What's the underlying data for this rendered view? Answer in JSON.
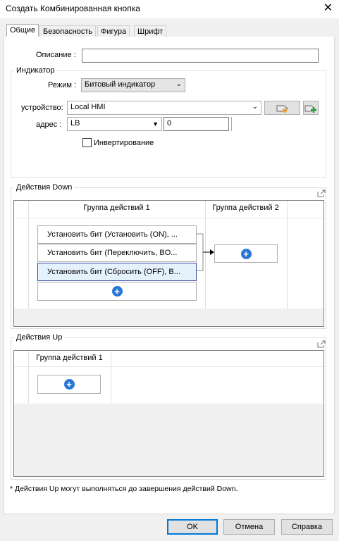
{
  "window": {
    "title": "Создать Комбинированная кнопка",
    "close_glyph": "✕"
  },
  "tabs": [
    {
      "label": "Общие",
      "active": true
    },
    {
      "label": "Безопасность",
      "active": false
    },
    {
      "label": "Фигура",
      "active": false
    },
    {
      "label": "Шрифт",
      "active": false
    }
  ],
  "description": {
    "label": "Описание :",
    "value": ""
  },
  "indicator": {
    "title": "Индикатор",
    "mode_label": "Режим :",
    "mode_value": "Битовый индикатор",
    "device_label": "устройство:",
    "device_value": "Local HMI",
    "address_label": "адрес :",
    "address_type": "LB",
    "address_value": "0",
    "invert_label": "Инвертирование",
    "invert_checked": false
  },
  "down_actions": {
    "title": "Действия Down",
    "groups": [
      {
        "title": "Группа действий 1",
        "actions": [
          {
            "label": "Установить бит (Установить (ON), ...",
            "selected": false
          },
          {
            "label": "Установить бит (Переключить, BO...",
            "selected": false
          },
          {
            "label": "Установить бит (Сбросить (OFF), B...",
            "selected": true
          }
        ]
      },
      {
        "title": "Группа действий 2",
        "actions": []
      }
    ]
  },
  "up_actions": {
    "title": "Действия Up",
    "groups": [
      {
        "title": "Группа действий 1",
        "actions": []
      }
    ]
  },
  "footnote": "* Действия Up могут выполняться до завершения действий Down.",
  "buttons": {
    "ok": "OK",
    "cancel": "Отмена",
    "help": "Справка"
  },
  "colors": {
    "accent": "#0078d7",
    "plus": "#2b78d4",
    "selection": "#e5f1fb"
  }
}
